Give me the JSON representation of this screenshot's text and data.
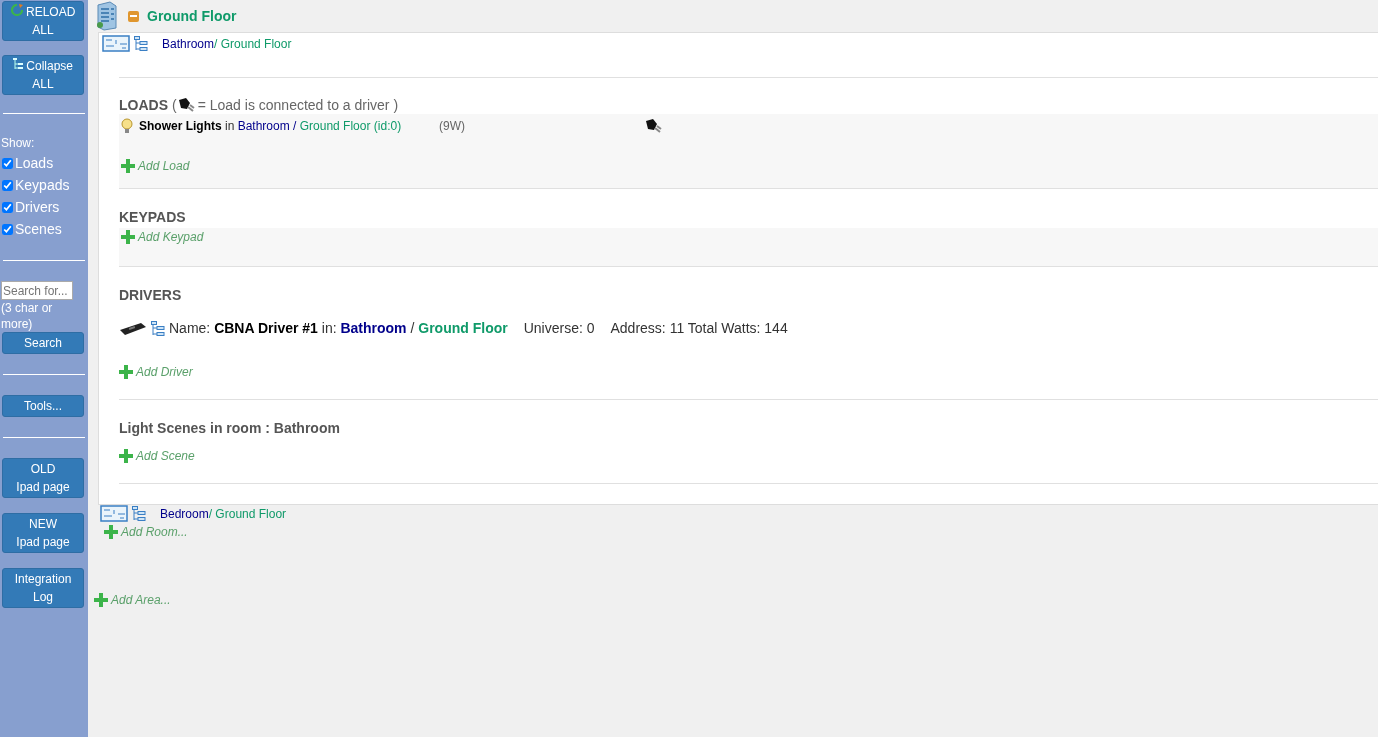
{
  "sidebar": {
    "top_buttons": [
      {
        "kind": "reload",
        "label": "RELOAD ALL"
      },
      {
        "kind": "collapse",
        "label": "Collapse ALL"
      }
    ],
    "show_label": "Show:",
    "filters": [
      {
        "label": "Loads",
        "checked": true
      },
      {
        "label": "Keypads",
        "checked": true
      },
      {
        "label": "Drivers",
        "checked": true
      },
      {
        "label": "Scenes",
        "checked": true
      }
    ],
    "search": {
      "placeholder": "Search for...",
      "hint": "(3 char or more)",
      "button": "Search"
    },
    "tools_button": "Tools...",
    "bottom_buttons": [
      {
        "line1": "OLD",
        "line2": "Ipad page"
      },
      {
        "line1": "NEW",
        "line2": "Ipad page"
      },
      {
        "line1": "Integration",
        "line2": "Log"
      }
    ]
  },
  "area": {
    "title": "Ground Floor",
    "expanded": true,
    "rooms": [
      {
        "name": "Bathroom",
        "floor": "/ Ground Floor",
        "expanded": true,
        "loads": {
          "heading": "LOADS",
          "legend_open": "(",
          "legend_text": "= Load is connected to a driver )",
          "items": [
            {
              "name": "Shower Lights",
              "in": "in",
              "room": "Bathroom",
              "sep": "/",
              "floor": "Ground Floor",
              "id": "(id:0)",
              "watts": "(9W)",
              "connected": true
            }
          ],
          "add": "Add Load"
        },
        "keypads": {
          "heading": "KEYPADS",
          "add": "Add Keypad"
        },
        "drivers": {
          "heading": "DRIVERS",
          "items": [
            {
              "name_label": "Name:",
              "name": "CBNA Driver #1",
              "in": "in:",
              "room": "Bathroom",
              "sep": "/",
              "floor": "Ground Floor",
              "universe": "Universe: 0",
              "address": "Address: 11",
              "total": "Total Watts: 144"
            }
          ],
          "add": "Add Driver"
        },
        "scenes": {
          "heading": "Light Scenes in room : Bathroom",
          "add": "Add Scene"
        }
      },
      {
        "name": "Bedroom",
        "floor": "/ Ground Floor",
        "expanded": false
      }
    ],
    "add_room": "Add Room...",
    "add_area": "Add Area..."
  }
}
